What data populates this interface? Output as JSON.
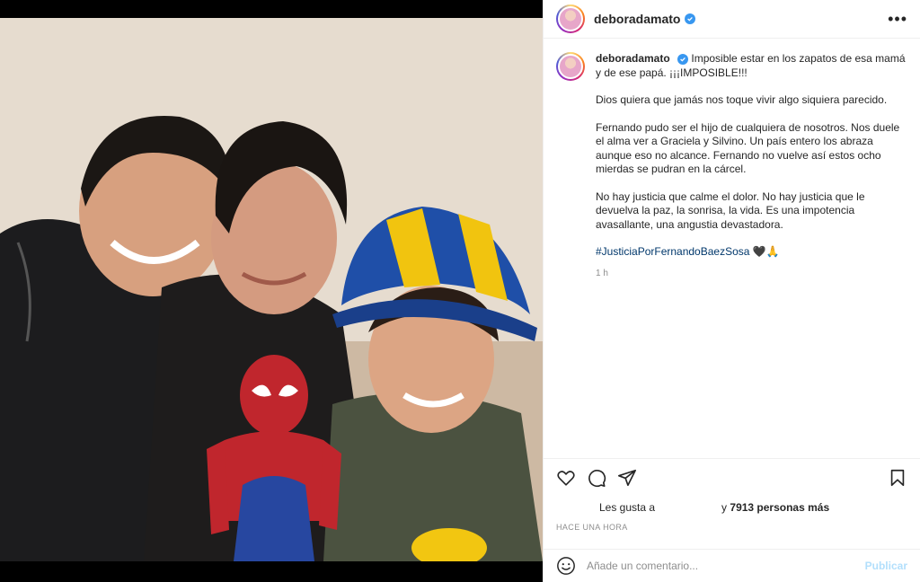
{
  "post": {
    "image_alt": "Family photo with a child wearing a blue and yellow hat holding a Spider-Man toy",
    "account": {
      "username": "deboradamato",
      "verified": true
    },
    "header": {
      "more_icon": "more-horizontal-icon",
      "more_label": "•••"
    },
    "caption": {
      "username": "deboradamato",
      "paragraphs": [
        "Imposible estar en los zapatos de esa mamá y de ese papá. ¡¡¡IMPOSIBLE!!!",
        "Dios quiera que jamás nos toque vivir algo siquiera parecido.",
        "Fernando pudo ser el hijo de cualquiera de nosotros. Nos duele el alma ver a Graciela y Silvino. Un país entero los abraza aunque eso no alcance. Fernando no vuelve así estos ocho mierdas se pudran en la cárcel.",
        "No hay justicia que calme el dolor. No hay justicia que le devuelva la paz, la sonrisa, la vida. Es una impotencia avasallante, una angustia devastadora."
      ],
      "hashtag": "#JusticiaPorFernandoBaezSosa",
      "emojis": "🖤🙏",
      "relative_time": "1 h"
    },
    "actions": {
      "like_icon": "heart-icon",
      "comment_icon": "comment-icon",
      "share_icon": "share-icon",
      "save_icon": "bookmark-icon"
    },
    "likes": {
      "prefix": "Les gusta a",
      "suffix_pre": "y",
      "count": "7913 personas más"
    },
    "timestamp": "HACE UNA HORA",
    "comment": {
      "placeholder": "Añade un comentario...",
      "post_label": "Publicar",
      "emoji_icon": "smiley-icon"
    },
    "colors": {
      "verified_blue": "#3897f0",
      "hashtag": "#00376b",
      "post_button_disabled": "#b2dffc",
      "muted": "#8e8e8e"
    }
  }
}
